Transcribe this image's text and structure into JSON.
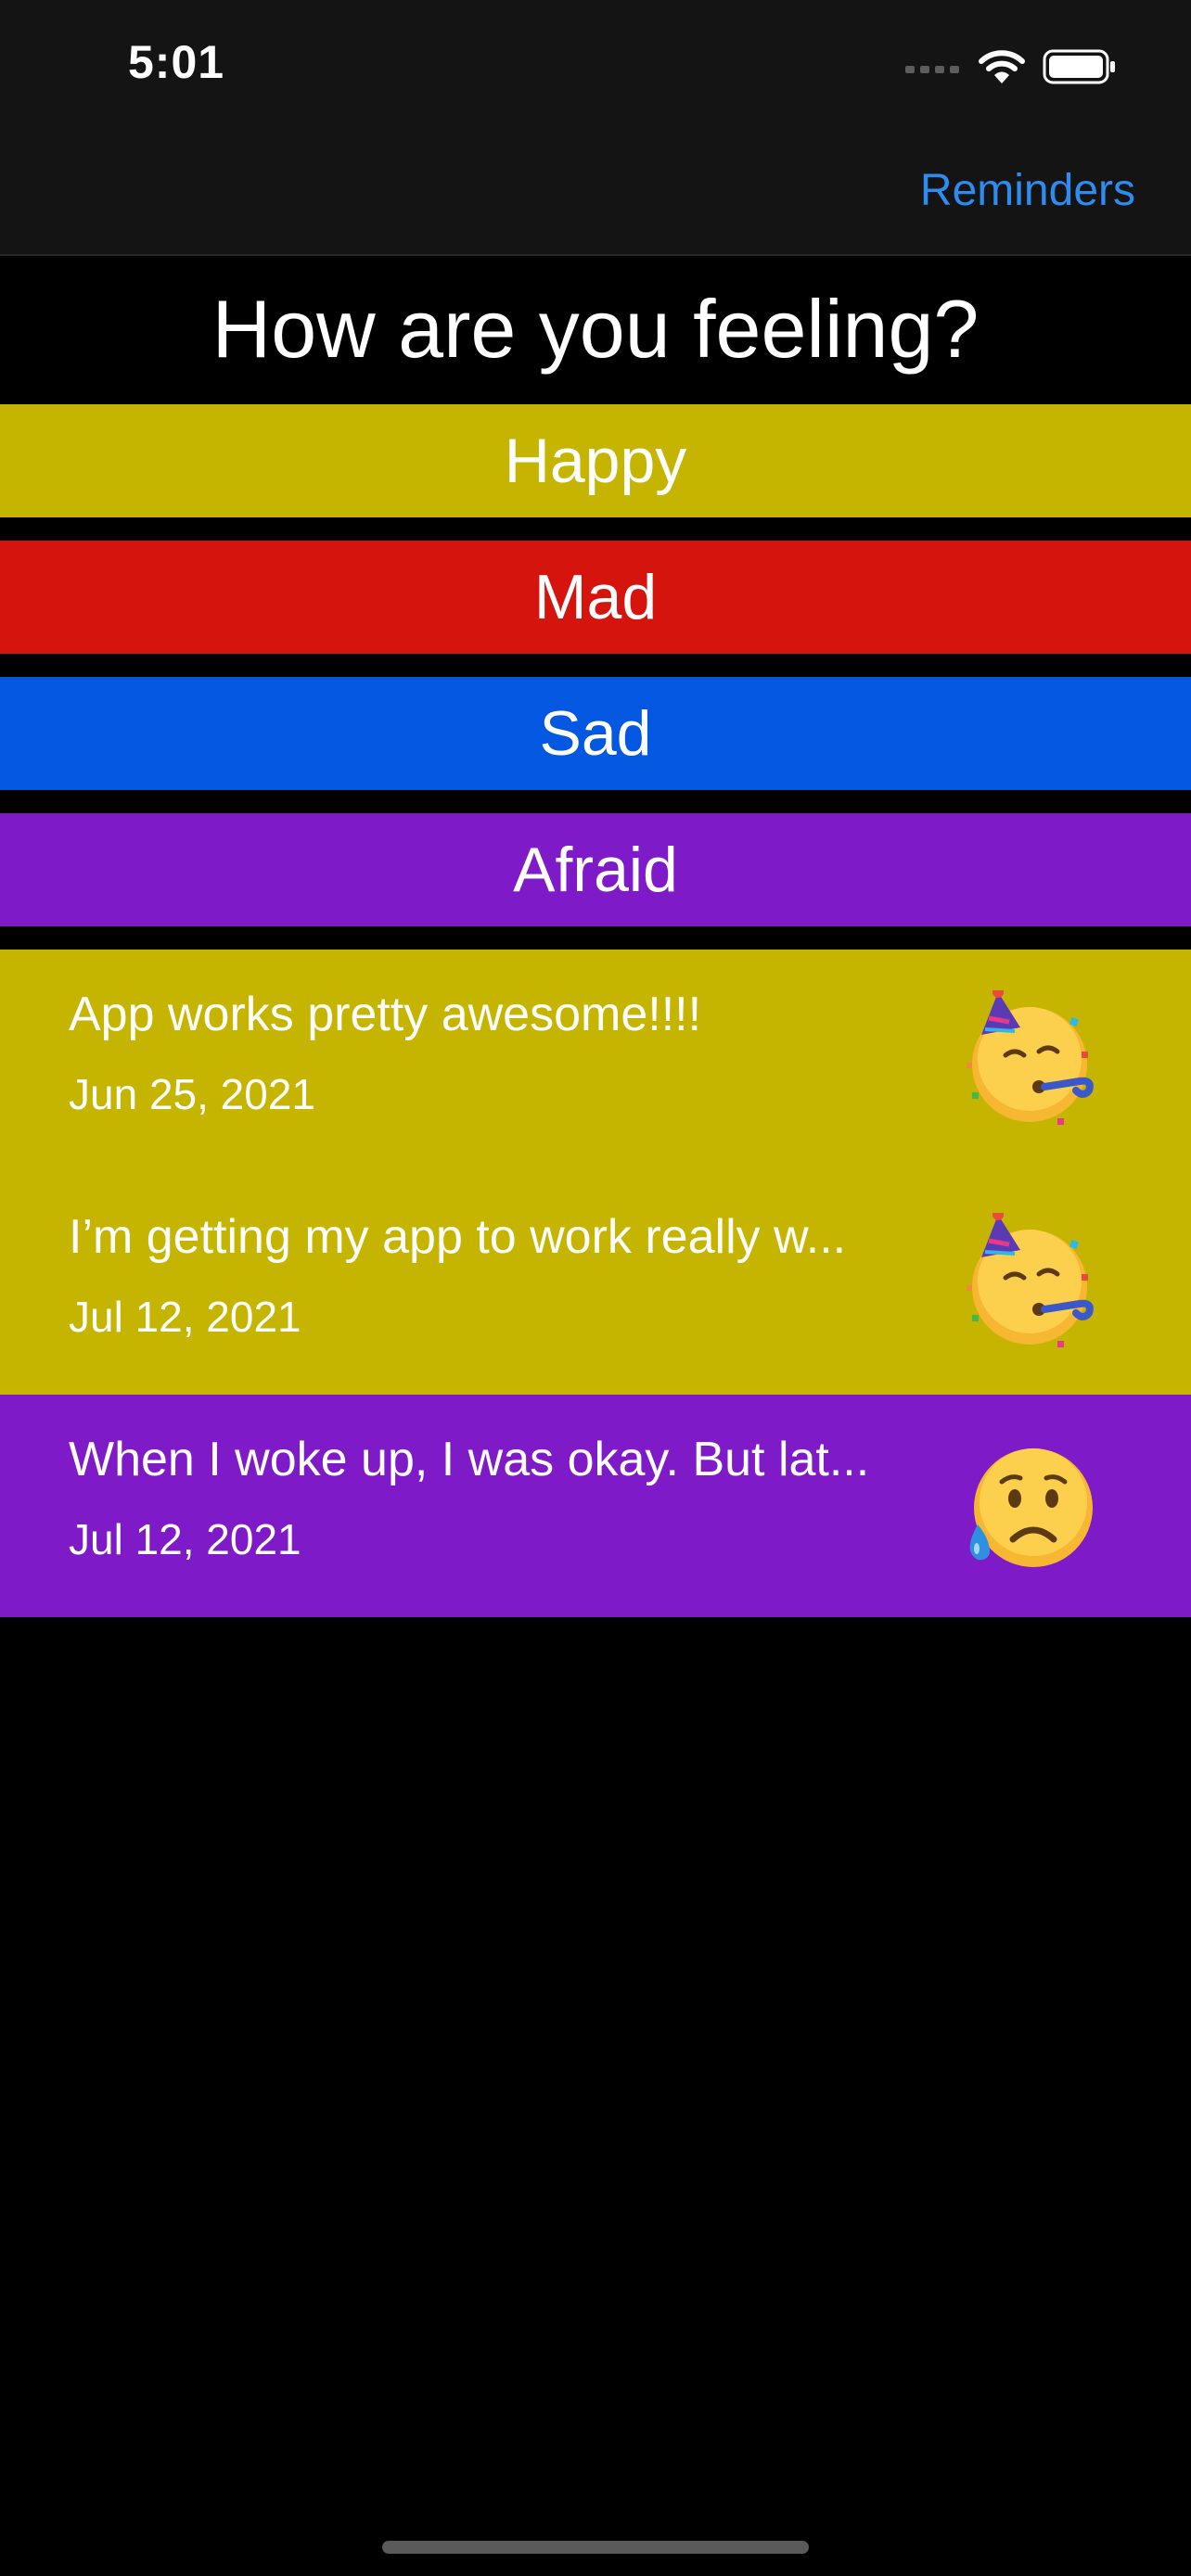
{
  "status_bar": {
    "time": "5:01",
    "icons": [
      "signal-icon",
      "wifi-icon",
      "battery-icon"
    ]
  },
  "nav": {
    "reminders_label": "Reminders",
    "accent": "#2e8cf0"
  },
  "title": "How are you feeling?",
  "moods": [
    {
      "label": "Happy",
      "color": "#c6b500"
    },
    {
      "label": "Mad",
      "color": "#d5140e"
    },
    {
      "label": "Sad",
      "color": "#0357e0"
    },
    {
      "label": "Afraid",
      "color": "#7e1ac7"
    }
  ],
  "entries": [
    {
      "text": "App works pretty awesome!!!!",
      "date": "Jun 25, 2021",
      "mood": "Happy",
      "emoji": "partying-face-icon",
      "color": "#c6b500"
    },
    {
      "text": "I’m getting my app to work really w...",
      "date": "Jul 12, 2021",
      "mood": "Happy",
      "emoji": "partying-face-icon",
      "color": "#c6b500"
    },
    {
      "text": "When I woke up, I was okay. But lat...",
      "date": "Jul 12, 2021",
      "mood": "Afraid",
      "emoji": "sad-sweat-face-icon",
      "color": "#7e1ac7"
    }
  ]
}
